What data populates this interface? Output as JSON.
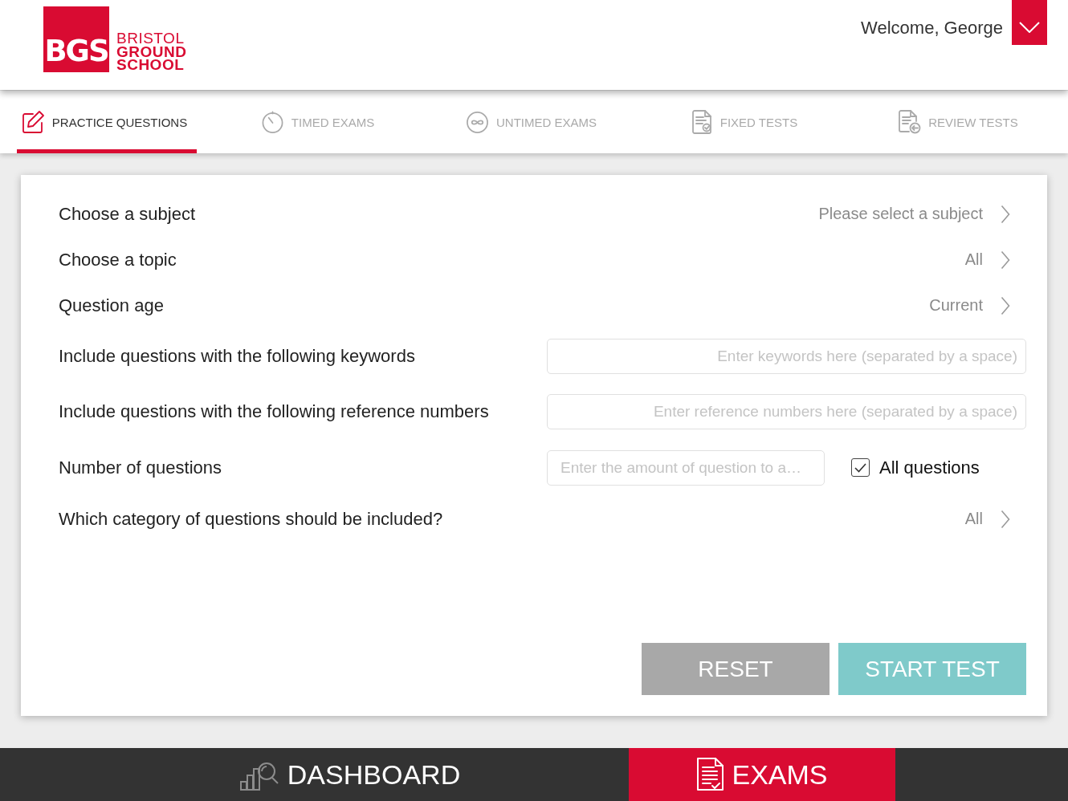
{
  "header": {
    "logo": {
      "badge": "BGS",
      "name_lines": [
        "BRISTOL",
        "GROUND",
        "SCHOOL"
      ]
    },
    "greeting": "Welcome, George"
  },
  "tabs": [
    {
      "kind": "practice",
      "label": "PRACTICE QUESTIONS",
      "selected": true
    },
    {
      "kind": "timed",
      "label": "TIMED EXAMS",
      "selected": false
    },
    {
      "kind": "untimed",
      "label": "UNTIMED EXAMS",
      "selected": false
    },
    {
      "kind": "fixed",
      "label": "FIXED TESTS",
      "selected": false
    },
    {
      "kind": "review",
      "label": "REVIEW TESTS",
      "selected": false
    }
  ],
  "form": {
    "rows": [
      {
        "kind": "select",
        "label": "Choose a subject",
        "value": "Please select a subject"
      },
      {
        "kind": "select",
        "label": "Choose a topic",
        "value": "All"
      },
      {
        "kind": "select",
        "label": "Question age",
        "value": "Current"
      },
      {
        "kind": "text",
        "label": "Include questions with the following keywords",
        "placeholder": "Enter keywords here (separated by a space)"
      },
      {
        "kind": "text",
        "label": "Include questions with the following reference numbers",
        "placeholder": "Enter reference numbers here (separated by a space)"
      },
      {
        "kind": "count",
        "label": "Number of questions",
        "placeholder": "Enter the amount of question to a…",
        "checkbox": {
          "label": "All questions",
          "checked": true
        }
      },
      {
        "kind": "select",
        "label": "Which category of questions should be included?",
        "value": "All"
      }
    ],
    "buttons": [
      {
        "kind": "reset",
        "label": "RESET"
      },
      {
        "kind": "start",
        "label": "START TEST"
      }
    ]
  },
  "bottom_nav": [
    {
      "kind": "dashboard",
      "label": "DASHBOARD",
      "selected": false
    },
    {
      "kind": "exams",
      "label": "EXAMS",
      "selected": true
    }
  ]
}
